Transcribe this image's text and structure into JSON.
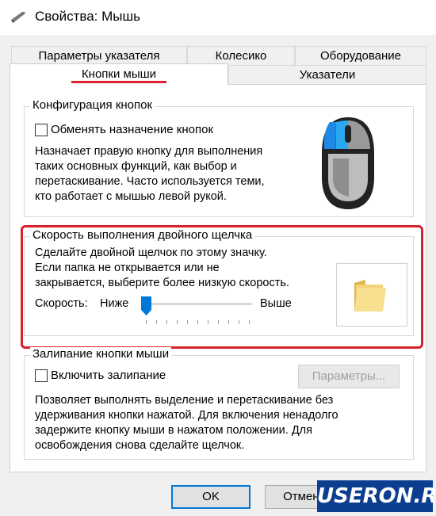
{
  "window": {
    "title": "Свойства: Мышь"
  },
  "tabs": {
    "row_back": [
      {
        "label": "Параметры указателя"
      },
      {
        "label": "Колесико"
      },
      {
        "label": "Оборудование"
      }
    ],
    "row_front": [
      {
        "label": "Кнопки мыши",
        "active": true
      },
      {
        "label": "Указатели",
        "active": false
      }
    ]
  },
  "button_config": {
    "legend": "Конфигурация кнопок",
    "checkbox_label": "Обменять назначение кнопок",
    "checked": false,
    "description_lines": [
      "Назначает правую кнопку для выполнения",
      "таких основных функций, как выбор и",
      "перетаскивание. Часто используется теми,",
      "кто работает с мышью левой рукой."
    ]
  },
  "double_click": {
    "legend": "Скорость выполнения двойного щелчка",
    "description_lines": [
      "Сделайте двойной щелчок по этому значку.",
      "Если папка не открывается или не",
      "закрывается, выберите более низкую скорость."
    ],
    "speed_label": "Скорость:",
    "slow_label": "Ниже",
    "fast_label": "Выше",
    "speed_value": 0.0,
    "tick_count": 11,
    "folder_icon": "folder-icon"
  },
  "click_lock": {
    "legend": "Залипание кнопки мыши",
    "checkbox_label": "Включить залипание",
    "checked": false,
    "settings_button": "Параметры...",
    "description_lines": [
      "Позволяет выполнять выделение и перетаскивание без",
      "удерживания кнопки нажатой. Для включения ненадолго",
      "задержите кнопку мыши в нажатом положении. Для",
      "освобождения снова сделайте щелчок."
    ]
  },
  "footer": {
    "ok": "OK",
    "cancel": "Отмена"
  },
  "watermark": "USERON.RU",
  "colors": {
    "accent": "#0078d7",
    "highlight_red": "#d9202b",
    "watermark_bg": "#0b3e8f"
  }
}
